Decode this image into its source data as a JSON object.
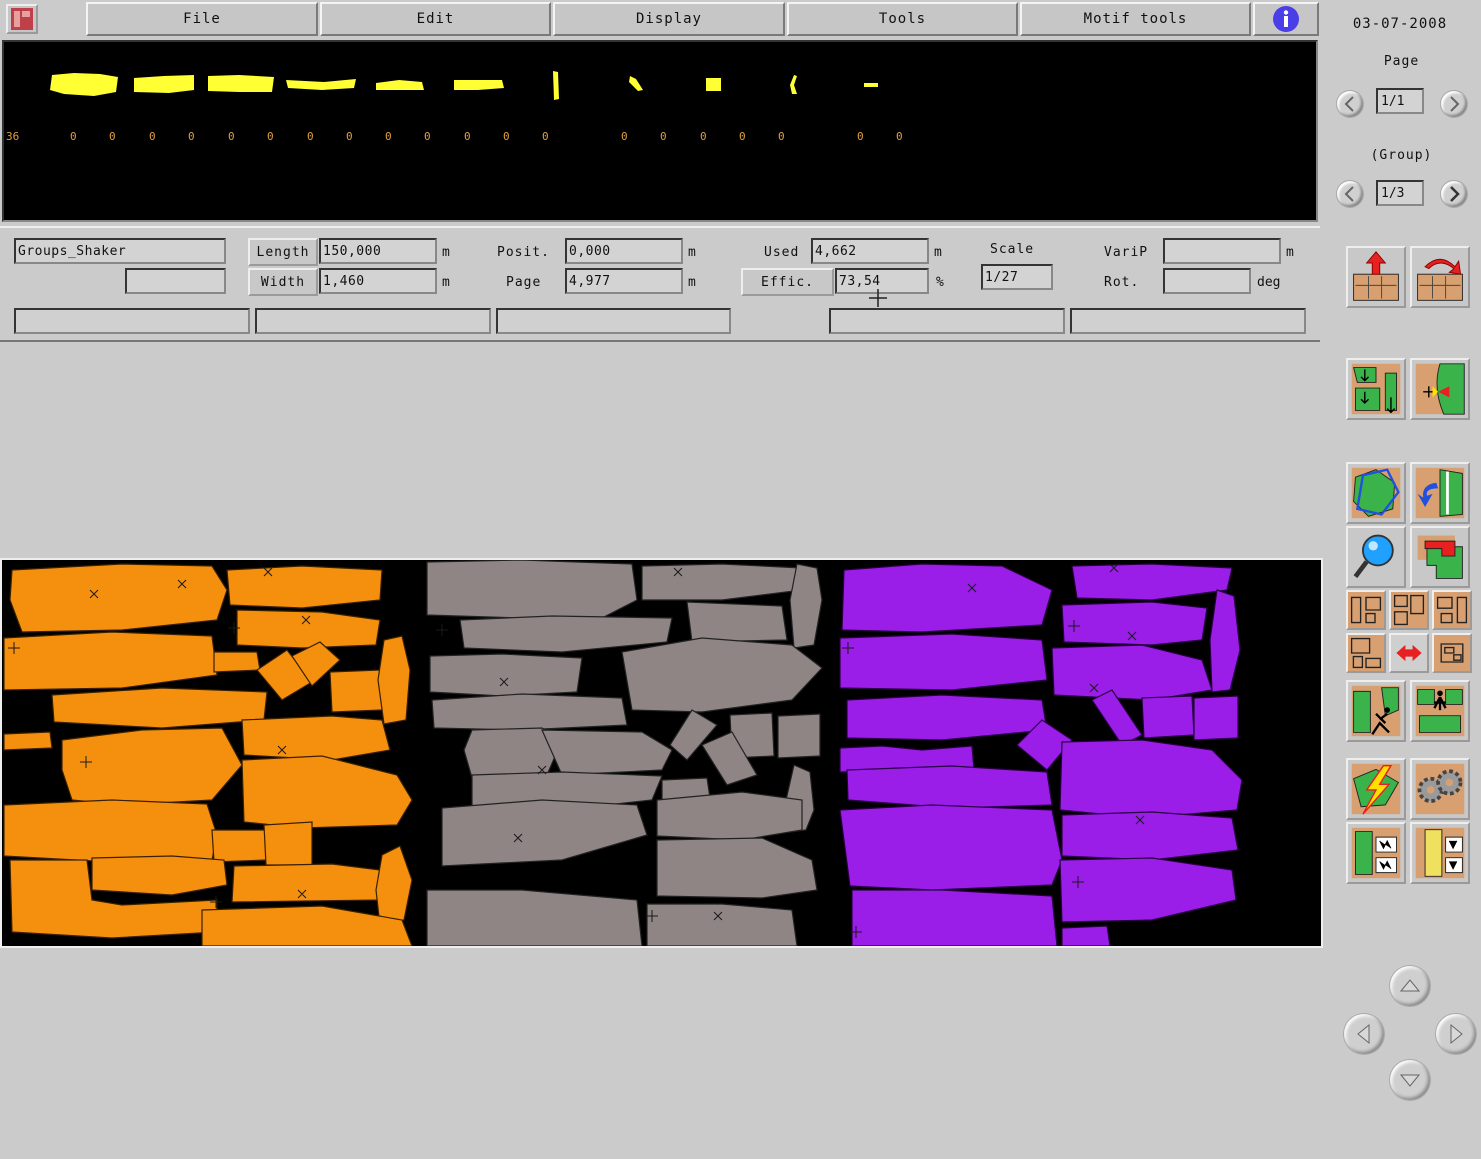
{
  "menu": {
    "items": [
      "File",
      "Edit",
      "Display",
      "Tools",
      "Motif tools"
    ],
    "date": "03-07-2008"
  },
  "thumbnails": {
    "first_label": "36",
    "counts": [
      "0",
      "0",
      "0",
      "0",
      "0",
      "0",
      "0",
      "0",
      "0",
      "0",
      "0",
      "0",
      "0",
      "0",
      "0",
      "0",
      "0",
      "0",
      "0",
      "0"
    ]
  },
  "nav": {
    "page_label": "Page",
    "page_value": "1/1",
    "group_label": "(Group)",
    "group_value": "1/3"
  },
  "info": {
    "name": "Groups_Shaker",
    "name2": "",
    "length_label": "Length",
    "length_value": "150,000",
    "length_unit": "m",
    "width_label": "Width",
    "width_value": "1,460",
    "width_unit": "m",
    "posit_label": "Posit.",
    "posit_value": "0,000",
    "posit_unit": "m",
    "page_label": "Page",
    "page_value": "4,977",
    "page_unit": "m",
    "used_label": "Used",
    "used_value": "4,662",
    "used_unit": "m",
    "effic_label": "Effic.",
    "effic_value": "73,54",
    "effic_unit": "%",
    "scale_label": "Scale",
    "scale_value": "1/27",
    "varip_label": "VariP",
    "varip_value": "",
    "varip_unit": "m",
    "rot_label": "Rot.",
    "rot_value": "",
    "rot_unit": "deg"
  },
  "colors": {
    "group1": "#f5900f",
    "group2": "#8e8584",
    "group3": "#9b1ee8",
    "thumb": "#ffff33",
    "count": "#e0a040"
  }
}
